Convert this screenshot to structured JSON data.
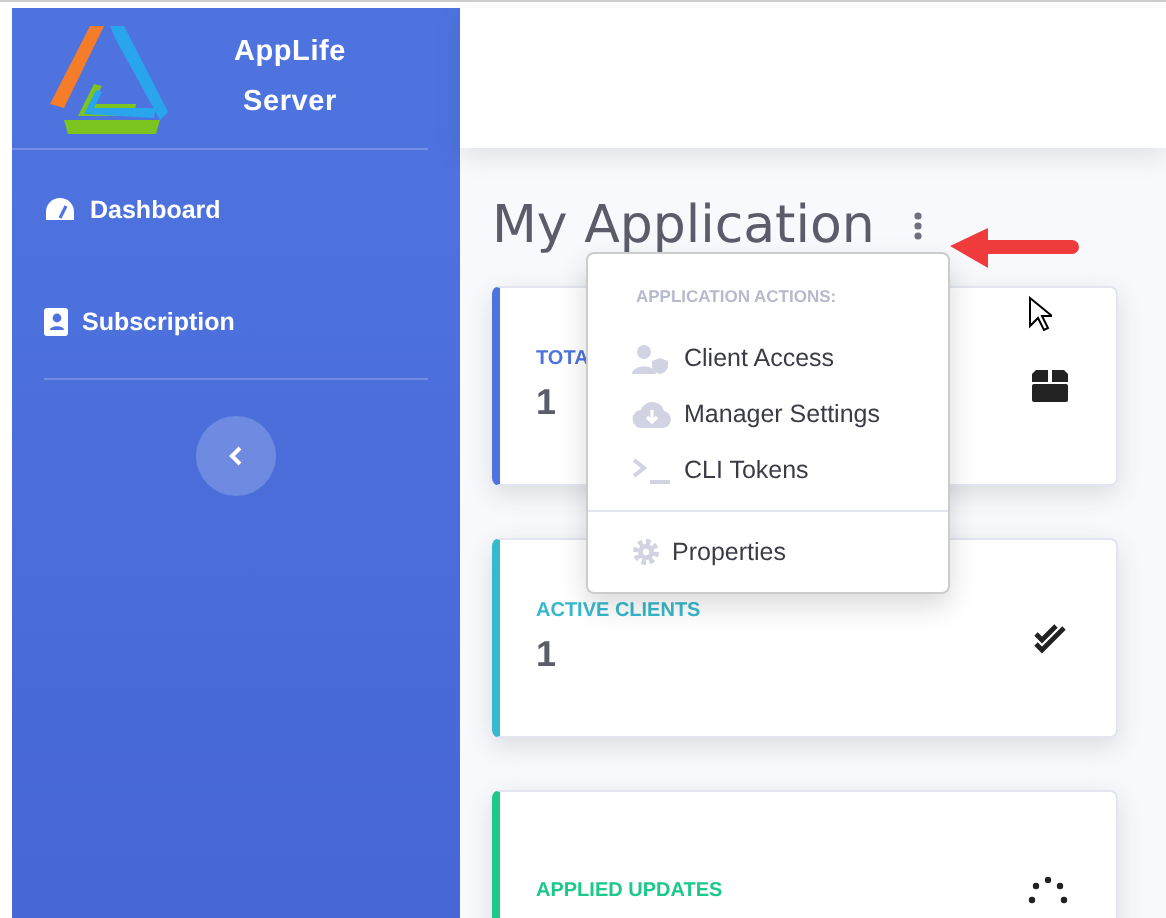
{
  "sidebar": {
    "brand": {
      "line1": "AppLife",
      "line2": "Server"
    },
    "items": [
      {
        "label": "Dashboard",
        "kind": "dashboard"
      },
      {
        "label": "Subscription",
        "kind": "subscription"
      }
    ]
  },
  "page": {
    "title": "My Application"
  },
  "menu": {
    "header": "APPLICATION ACTIONS:",
    "items": [
      {
        "label": "Client Access",
        "kind": "client"
      },
      {
        "label": "Manager Settings",
        "kind": "cloud"
      },
      {
        "label": "CLI Tokens",
        "kind": "terminal"
      },
      {
        "label": "Properties",
        "kind": "gear"
      }
    ]
  },
  "cards": [
    {
      "label": "TOTA",
      "value": "1",
      "color": "#4e73df",
      "kind": "box"
    },
    {
      "label": "ACTIVE CLIENTS",
      "value": "1",
      "color": "#36b9cc",
      "kind": "check"
    },
    {
      "label": "APPLIED UPDATES",
      "color": "#1cc88a",
      "kind": "spinner"
    }
  ]
}
